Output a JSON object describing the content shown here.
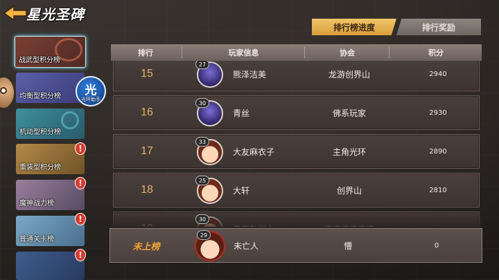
{
  "header": {
    "title": "星光圣碑"
  },
  "tabs": [
    {
      "label": "排行榜进度",
      "active": true
    },
    {
      "label": "排行奖励",
      "active": false
    }
  ],
  "sidebar": {
    "categories": [
      {
        "label": "战武型积分榜",
        "selected": true,
        "alert": false
      },
      {
        "label": "均衡型积分榜",
        "selected": false,
        "alert": false
      },
      {
        "label": "机动型积分榜",
        "selected": false,
        "alert": false
      },
      {
        "label": "重装型积分榜",
        "selected": false,
        "alert": true
      },
      {
        "label": "魔神战力榜",
        "selected": false,
        "alert": true
      },
      {
        "label": "普通关卡榜",
        "selected": false,
        "alert": true
      },
      {
        "label": "",
        "selected": false,
        "alert": true
      }
    ],
    "alert_symbol": "!",
    "helper": {
      "glyph": "光",
      "label": "光环助手"
    }
  },
  "table": {
    "columns": [
      "排行",
      "玩家信息",
      "协会",
      "积分"
    ],
    "rows": [
      {
        "rank": "15",
        "level": "27",
        "avatar": "purple-mech",
        "name": "熊泽洁美",
        "guild": "龙游创界山",
        "score": "2940"
      },
      {
        "rank": "16",
        "level": "30",
        "avatar": "purple-mech",
        "name": "青丝",
        "guild": "佛系玩家",
        "score": "2930"
      },
      {
        "rank": "17",
        "level": "33",
        "avatar": "hero-face",
        "name": "大友麻衣子",
        "guild": "主角光环",
        "score": "2890"
      },
      {
        "rank": "18",
        "level": "25",
        "avatar": "hero-face",
        "name": "大轩",
        "guild": "创界山",
        "score": "2810"
      },
      {
        "rank": "19",
        "level": "30",
        "avatar": "hero-face",
        "name": "乌田敦州大",
        "guild": "滚滚滚滚滚滚",
        "score": ""
      }
    ]
  },
  "self": {
    "rank": "未上榜",
    "level": "29",
    "name": "未亡人",
    "guild": "懵",
    "score": "0"
  },
  "colors": {
    "tab_active": "#e8b552",
    "rank_text": "#e5b36a",
    "self_rank_text": "#f2a43a",
    "alert_badge": "#d73a2e"
  }
}
